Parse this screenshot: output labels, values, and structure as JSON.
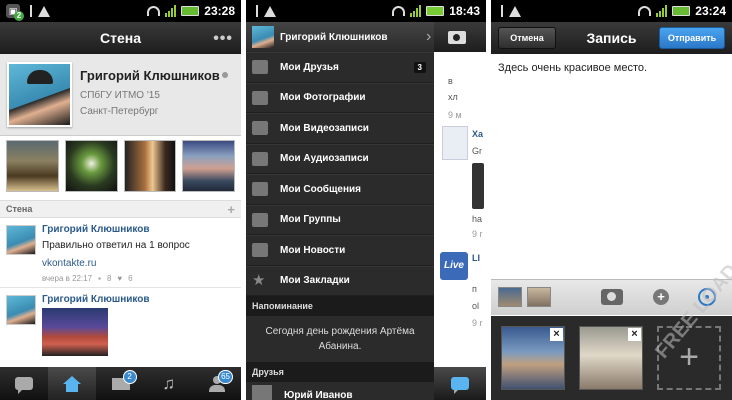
{
  "panel1": {
    "status": {
      "time": "23:28",
      "notif_badge": "2"
    },
    "title": "Стена",
    "more": "•••",
    "profile": {
      "name": "Григорий Клюшников",
      "university": "СПбГУ ИТМО '15",
      "city": "Санкт-Петербург"
    },
    "wall_section": "Стена",
    "add_symbol": "+",
    "posts": [
      {
        "author": "Григорий Клюшников",
        "text": "Правильно ответил на 1 вопрос",
        "link": "vkontakte.ru",
        "time": "вчера в 22:17",
        "comments": "8",
        "likes": "6"
      },
      {
        "author": "Григорий Клюшников"
      }
    ],
    "bottom_nav": {
      "messages_badge": "2",
      "friends_badge": "65"
    }
  },
  "panel2": {
    "status": {
      "time": "18:43"
    },
    "menu_user": "Григорий Клюшников",
    "menu_items": [
      {
        "label": "Мои Друзья",
        "count": "3"
      },
      {
        "label": "Мои Фотографии"
      },
      {
        "label": "Мои Видеозаписи"
      },
      {
        "label": "Мои Аудиозаписи"
      },
      {
        "label": "Мои Сообщения"
      },
      {
        "label": "Мои Группы"
      },
      {
        "label": "Мои Новости"
      },
      {
        "label": "Мои Закладки"
      }
    ],
    "reminder_header": "Напоминание",
    "reminder_text": "Сегодня день рождения Артёма Абанина.",
    "friends_header": "Друзья",
    "friend_name": "Юрий Иванов",
    "strip": {
      "item1_a": "в",
      "item1_b": "хл",
      "item1_c": "9 м",
      "item2_title": "Ха",
      "item2_b": "Gr",
      "item3_b": "ha",
      "item3_c": "9 r",
      "item4_title": "LI",
      "item4_b": "п",
      "item4_c": "ol",
      "item4_d": "9 r",
      "live_logo": "Live"
    }
  },
  "panel3": {
    "status": {
      "time": "23:24"
    },
    "title": "Запись",
    "cancel": "Отмена",
    "send": "Отправить",
    "text": "Здесь очень красивое место.",
    "remove": "×",
    "add": "+",
    "watermark": "FREE LOAD"
  }
}
